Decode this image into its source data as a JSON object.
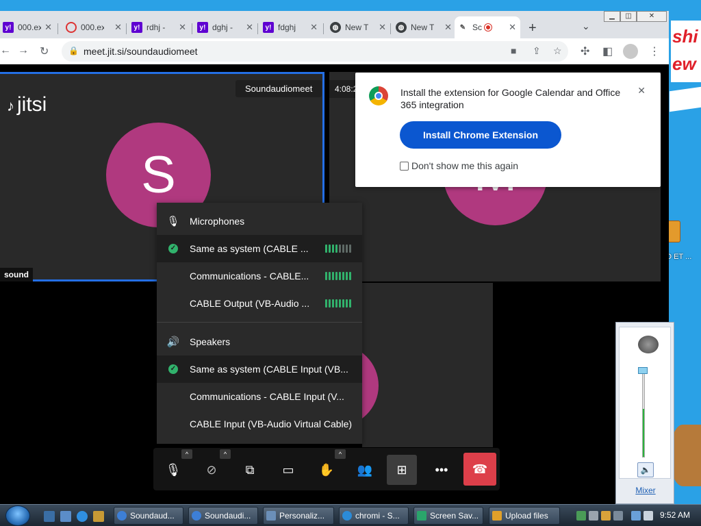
{
  "desktop": {
    "text_top": "shi",
    "text_bottom": "ew",
    "icon_label": "GO ET ..."
  },
  "browser": {
    "tabs": [
      {
        "label": "000.ex",
        "favicon": "yahoo"
      },
      {
        "label": "000.ex",
        "favicon": "red-ring"
      },
      {
        "label": "rdhj -",
        "favicon": "yahoo"
      },
      {
        "label": "dghj -",
        "favicon": "yahoo"
      },
      {
        "label": "fdghj",
        "favicon": "yahoo"
      },
      {
        "label": "New T",
        "favicon": "globe"
      },
      {
        "label": "New T",
        "favicon": "globe"
      },
      {
        "label": "Sc",
        "favicon": "feather",
        "active": true,
        "recording": true
      }
    ],
    "url": "meet.jit.si/soundaudiomeet"
  },
  "meeting": {
    "logo": "jitsi",
    "title": "Soundaudiomeet",
    "timer": "4:08:2",
    "self_initial": "S",
    "self_name": "sound",
    "remote_initial": "M"
  },
  "extension_popup": {
    "message": "Install the extension for Google Calendar and Office 365 integration",
    "install_button": "Install Chrome Extension",
    "dont_show": "Don't show me this again"
  },
  "audio_menu": {
    "microphones_header": "Microphones",
    "microphones": [
      {
        "label": "Same as system (CABLE ...",
        "selected": true,
        "level": 4
      },
      {
        "label": "Communications - CABLE...",
        "selected": false,
        "level": 8
      },
      {
        "label": "CABLE Output (VB-Audio ...",
        "selected": false,
        "level": 8
      }
    ],
    "speakers_header": "Speakers",
    "speakers": [
      {
        "label": "Same as system (CABLE Input (VB...",
        "selected": true
      },
      {
        "label": "Communications - CABLE Input (V...",
        "selected": false
      },
      {
        "label": "CABLE Input (VB-Audio Virtual Cable)",
        "selected": false
      }
    ]
  },
  "mixer": {
    "link": "Mixer",
    "level": 0.55
  },
  "taskbar": {
    "tasks": [
      {
        "label": "Soundaud...",
        "color": "#3d7fd6"
      },
      {
        "label": "Soundaudi...",
        "color": "#3d7fd6"
      },
      {
        "label": "Personaliz...",
        "color": "#6b8fb8"
      },
      {
        "label": "chromi - S...",
        "color": "#2b8bd8"
      },
      {
        "label": "Screen Sav...",
        "color": "#2aa56b"
      },
      {
        "label": "Upload files",
        "color": "#e0a02a"
      }
    ],
    "clock": "9:52 AM"
  }
}
